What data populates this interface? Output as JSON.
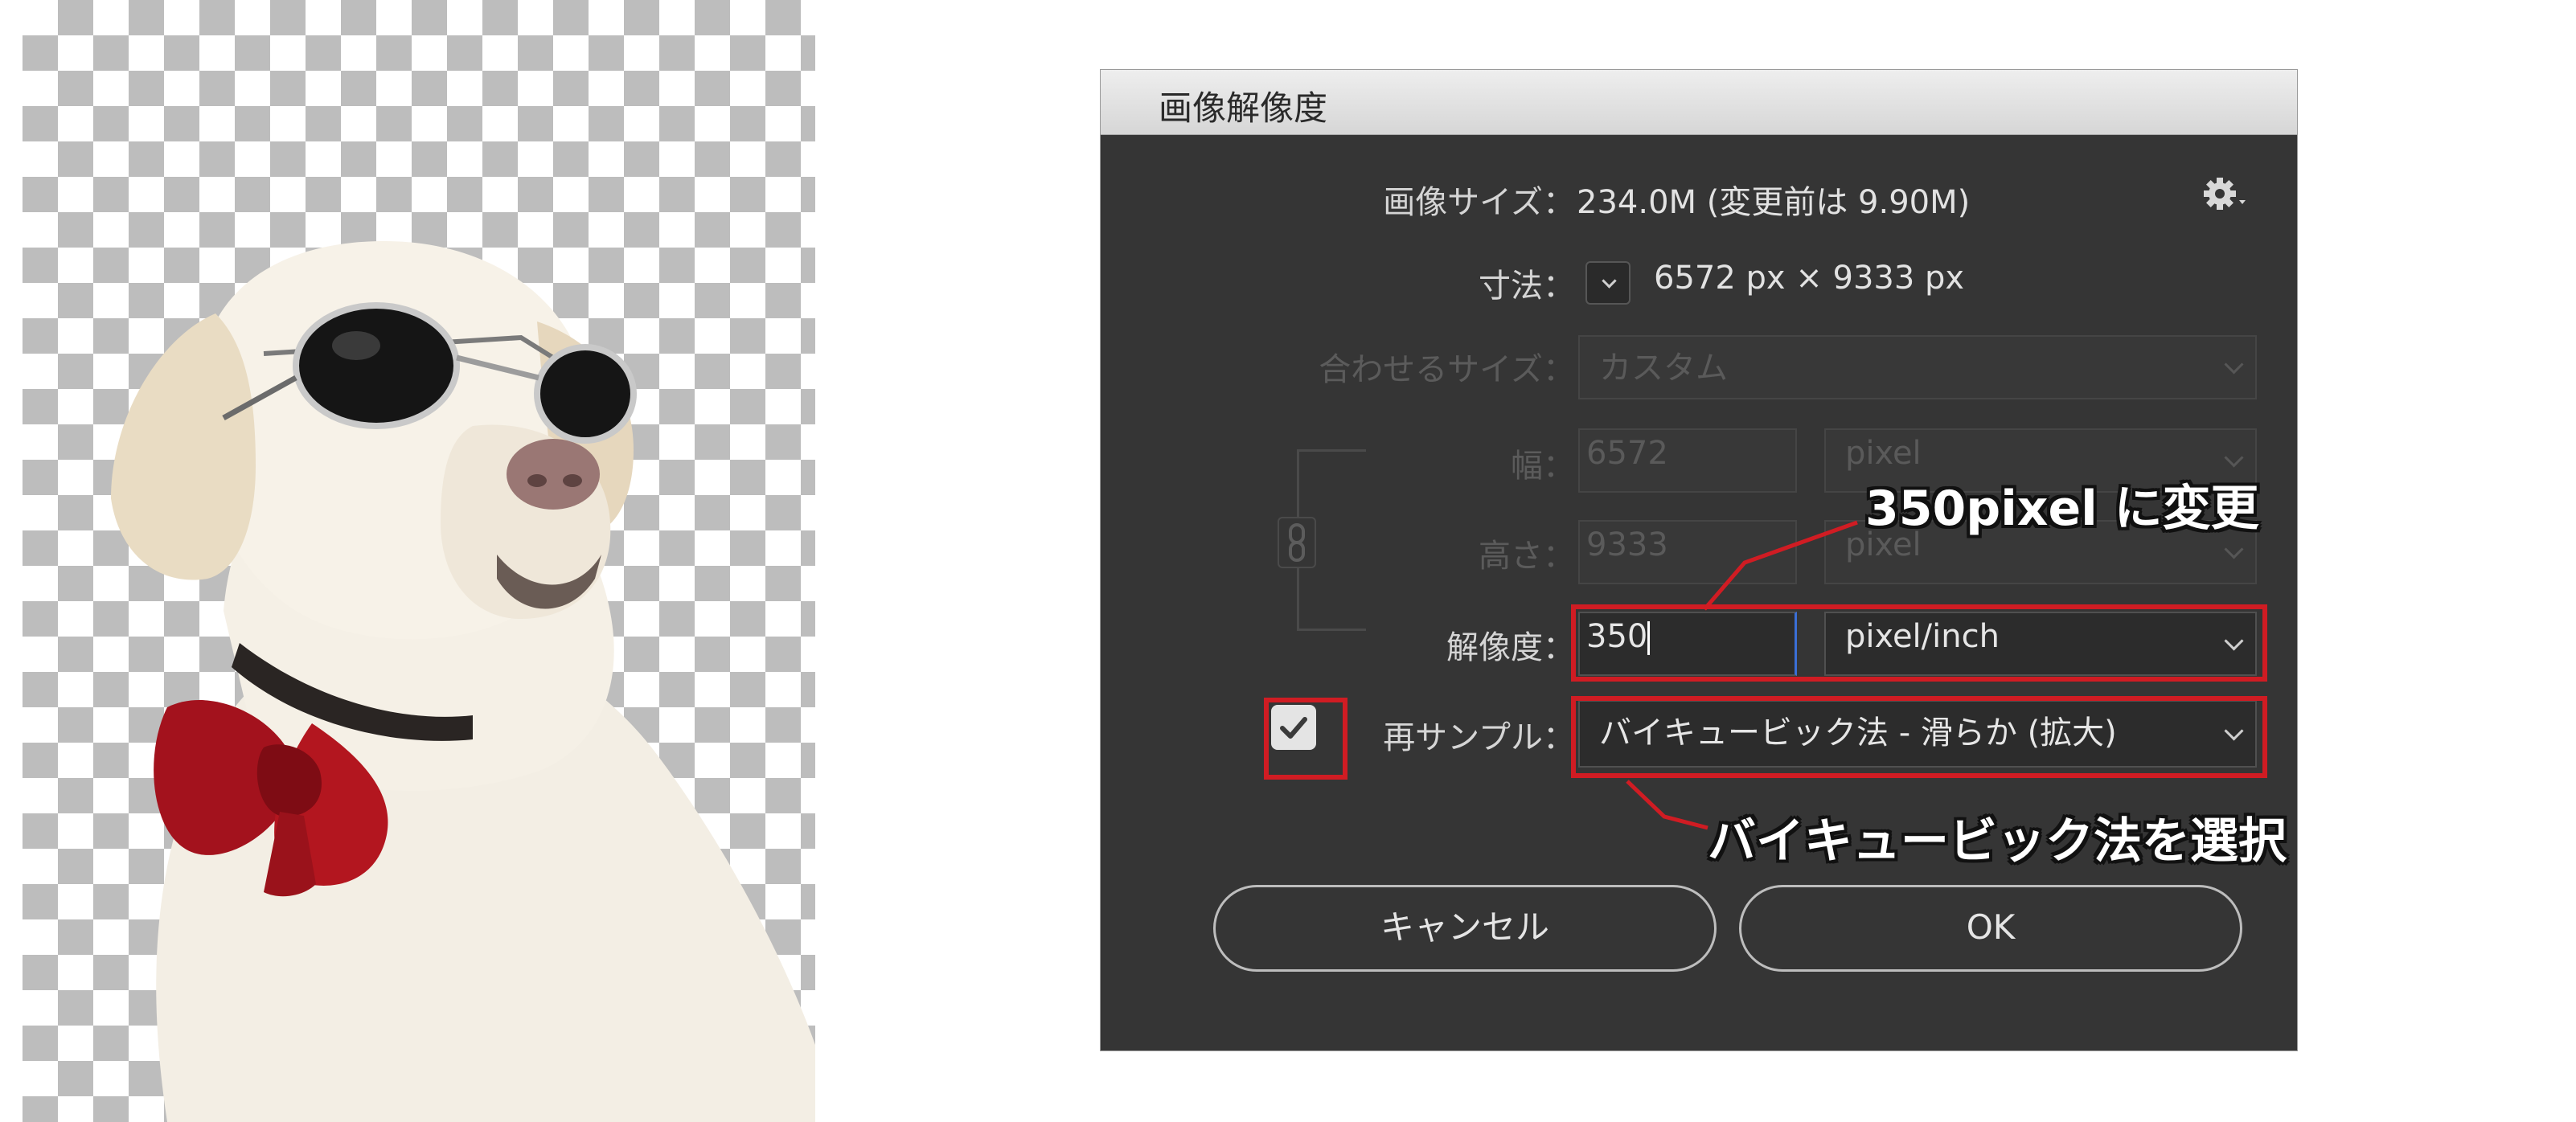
{
  "dialog": {
    "title": "画像解像度",
    "image_size_label": "画像サイズ：",
    "image_size_value": "234.0M (変更前は 9.90M)",
    "dimensions_label": "寸法：",
    "dimensions_value": "6572 px × 9333 px",
    "fit_to_label": "合わせるサイズ：",
    "fit_to_value": "カスタム",
    "width_label": "幅：",
    "width_value": "6572",
    "width_unit": "pixel",
    "height_label": "高さ：",
    "height_value": "9333",
    "height_unit": "pixel",
    "resolution_label": "解像度：",
    "resolution_value": "350",
    "resolution_unit": "pixel/inch",
    "resample_label": "再サンプル：",
    "resample_checked": true,
    "resample_value": "バイキュービック法 - 滑らか (拡大)",
    "cancel_label": "キャンセル",
    "ok_label": "OK"
  },
  "annotations": {
    "resolution_note": "350pixel に変更",
    "resample_note": "バイキュービック法を選択"
  },
  "colors": {
    "highlight": "#d01c23",
    "dialog_bg": "#353535"
  },
  "icons": [
    "gear-icon",
    "chevron-down-icon",
    "link-chain-icon",
    "checkmark-icon"
  ]
}
